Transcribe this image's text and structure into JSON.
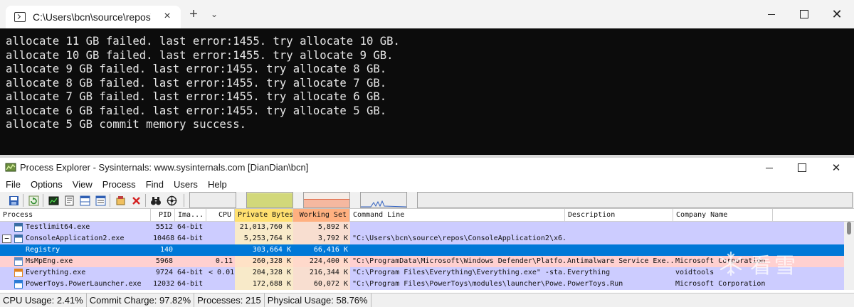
{
  "terminal": {
    "tab_title": "C:\\Users\\bcn\\source\\repos\\Cc",
    "tab_close": "×",
    "new_tab": "+",
    "dropdown": "⌄",
    "win_close": "✕",
    "lines": [
      "allocate 11 GB failed. last error:1455. try allocate 10 GB.",
      "allocate 10 GB failed. last error:1455. try allocate 9 GB.",
      "allocate 9 GB failed. last error:1455. try allocate 8 GB.",
      "allocate 8 GB failed. last error:1455. try allocate 7 GB.",
      "allocate 7 GB failed. last error:1455. try allocate 6 GB.",
      "allocate 6 GB failed. last error:1455. try allocate 5 GB.",
      "allocate 5 GB commit memory success."
    ]
  },
  "procexp": {
    "title": "Process Explorer - Sysinternals: www.sysinternals.com [DianDian\\bcn]",
    "win_close": "✕",
    "menu": [
      "File",
      "Options",
      "View",
      "Process",
      "Find",
      "Users",
      "Help"
    ],
    "columns": {
      "process": "Process",
      "pid": "PID",
      "image": "Ima...",
      "cpu": "CPU",
      "private_bytes": "Private Bytes",
      "working_set": "Working Set",
      "command_line": "Command Line",
      "description": "Description",
      "company": "Company Name"
    },
    "rows": [
      {
        "name": "Testlimit64.exe",
        "pid": "5512",
        "image": "64-bit",
        "cpu": "",
        "private": "21,013,760 K",
        "working": "5,892 K",
        "cmd": "",
        "desc": "",
        "company": "",
        "bg": "#ccccff",
        "expander": "",
        "icon_color": "#3a6ea5"
      },
      {
        "name": "ConsoleApplication2.exe",
        "pid": "10468",
        "image": "64-bit",
        "cpu": "",
        "private": "5,253,764 K",
        "working": "3,792 K",
        "cmd": "\"C:\\Users\\bcn\\source\\repos\\ConsoleApplication2\\x6...",
        "desc": "",
        "company": "",
        "bg": "#ccccff",
        "expander": "−",
        "icon_color": "#3a6ea5"
      },
      {
        "name": "Registry",
        "pid": "140",
        "image": "",
        "cpu": "",
        "private": "303,664 K",
        "working": "66,416 K",
        "cmd": "",
        "desc": "",
        "company": "",
        "bg": "#0078d7",
        "expander": "",
        "icon_color": ""
      },
      {
        "name": "MsMpEng.exe",
        "pid": "5968",
        "image": "",
        "cpu": "0.11",
        "private": "260,328 K",
        "working": "224,400 K",
        "cmd": "\"C:\\ProgramData\\Microsoft\\Windows Defender\\Platfo...",
        "desc": "Antimalware Service Exe...",
        "company": "Microsoft Corporation",
        "bg": "#ffd0d0",
        "expander": "",
        "icon_color": "#5b8dc8"
      },
      {
        "name": "Everything.exe",
        "pid": "9724",
        "image": "64-bit",
        "cpu": "< 0.01",
        "private": "204,328 K",
        "working": "216,344 K",
        "cmd": "\"C:\\Program Files\\Everything\\Everything.exe\" -sta...",
        "desc": "Everything",
        "company": "voidtools",
        "bg": "#ccccff",
        "expander": "",
        "icon_color": "#e0821e"
      },
      {
        "name": "PowerToys.PowerLauncher.exe",
        "pid": "12032",
        "image": "64-bit",
        "cpu": "",
        "private": "172,688 K",
        "working": "60,072 K",
        "cmd": "\"C:\\Program Files\\PowerToys\\modules\\launcher\\Powe...",
        "desc": "PowerToys.Run",
        "company": "Microsoft Corporation",
        "bg": "#ccccff",
        "expander": "",
        "icon_color": "#2b7bd6"
      }
    ],
    "status": {
      "cpu": "CPU Usage: 2.41%",
      "commit": "Commit Charge: 97.82%",
      "processes": "Processes: 215",
      "physical": "Physical Usage: 58.76%"
    },
    "watermark": "看雪",
    "colors": {
      "selected_row": "#0078d7",
      "own_process": "#ccccff",
      "service": "#ffd0d0",
      "private_bytes_col": "#ffeec0",
      "working_set_col": "#ffe0c8"
    }
  }
}
